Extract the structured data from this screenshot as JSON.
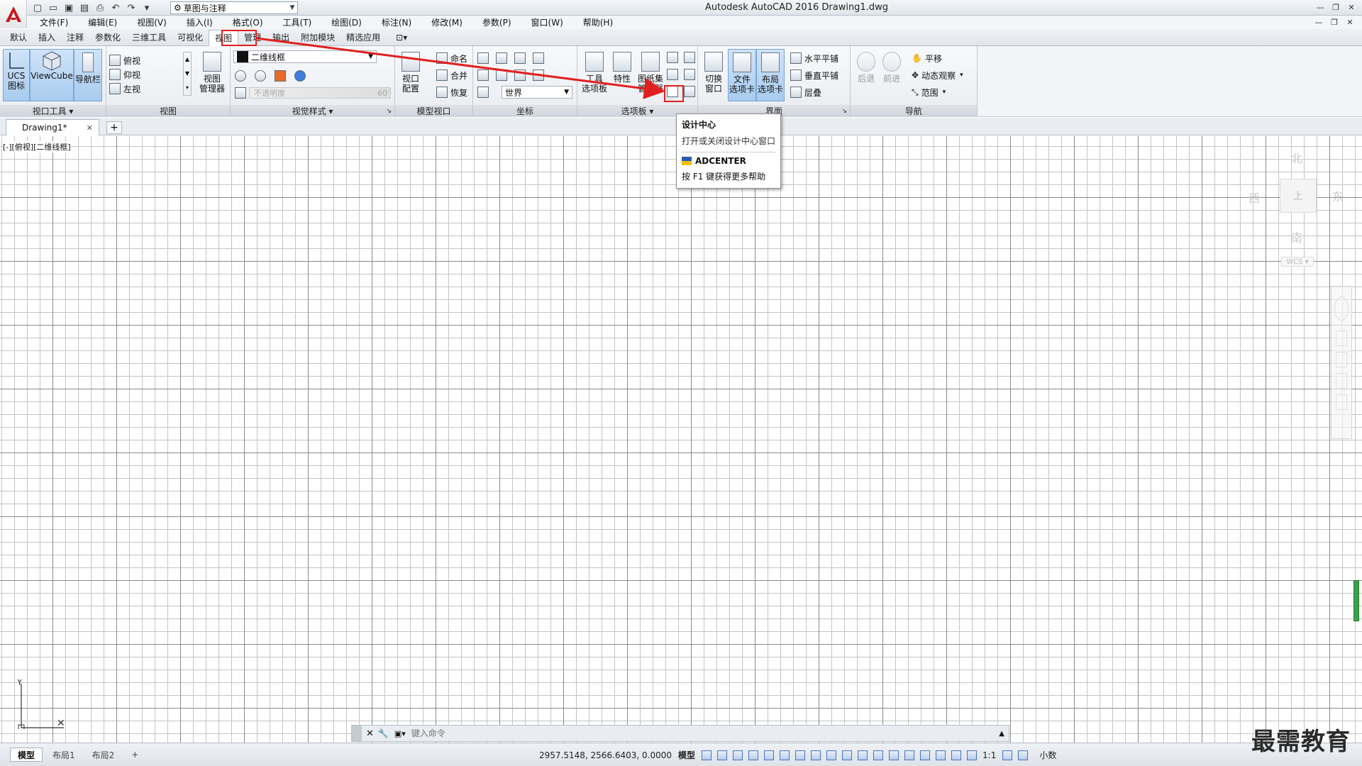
{
  "window": {
    "title": "Autodesk AutoCAD 2016    Drawing1.dwg",
    "workspace": "草图与注释"
  },
  "menus": [
    "文件(F)",
    "编辑(E)",
    "视图(V)",
    "插入(I)",
    "格式(O)",
    "工具(T)",
    "绘图(D)",
    "标注(N)",
    "修改(M)",
    "参数(P)",
    "窗口(W)",
    "帮助(H)"
  ],
  "ribbon_tabs": [
    "默认",
    "插入",
    "注释",
    "参数化",
    "三维工具",
    "可视化",
    "视图",
    "管理",
    "输出",
    "附加模块",
    "精选应用"
  ],
  "active_tab": "视图",
  "panels": {
    "viewport_tools": {
      "title": "视口工具",
      "buttons": [
        "UCS\n图标",
        "ViewCube",
        "导航栏"
      ]
    },
    "views": {
      "title": "视图",
      "items": [
        "俯视",
        "仰视",
        "左视"
      ],
      "manager": "视图\n管理器"
    },
    "visual_styles": {
      "title": "视觉样式",
      "current": "二维线框",
      "transparency_label": "不透明度",
      "transparency_value": "60"
    },
    "model_viewports": {
      "title": "模型视口",
      "config": "视口\n配置",
      "named": "命名",
      "join": "合并",
      "restore": "恢复"
    },
    "coordinates": {
      "title": "坐标",
      "world": "世界"
    },
    "palettes": {
      "title": "选项板",
      "tool": "工具\n选项板",
      "props": "特性",
      "sheetset": "图纸集\n管理器"
    },
    "interface": {
      "title": "界面",
      "switch": "切换\n窗口",
      "filetabs": "文件\n选项卡",
      "layouttabs": "布局\n选项卡",
      "tile_h": "水平平铺",
      "tile_v": "垂直平铺",
      "cascade": "层叠"
    },
    "navigate": {
      "title": "导航",
      "back": "后退",
      "forward": "前进",
      "pan": "平移",
      "orbit": "动态观察",
      "extents": "范围"
    }
  },
  "tooltip": {
    "title": "设计中心",
    "desc": "打开或关闭设计中心窗口",
    "command": "ADCENTER",
    "help": "按 F1 键获得更多帮助"
  },
  "doc_tab": "Drawing1*",
  "view_label": "[-][俯视][二维线框]",
  "viewcube": {
    "n": "北",
    "s": "南",
    "e": "东",
    "w": "西",
    "top": "上",
    "wcs": "WCS"
  },
  "command": {
    "placeholder": "键入命令"
  },
  "layout_tabs": [
    "模型",
    "布局1",
    "布局2"
  ],
  "status": {
    "coords": "2957.5148, 2566.6403, 0.0000",
    "space": "模型",
    "scale": "1:1",
    "units": "小数"
  },
  "watermark": "最需教育",
  "colors": {
    "accent": "#4a90d9",
    "highlight": "#e02020"
  }
}
